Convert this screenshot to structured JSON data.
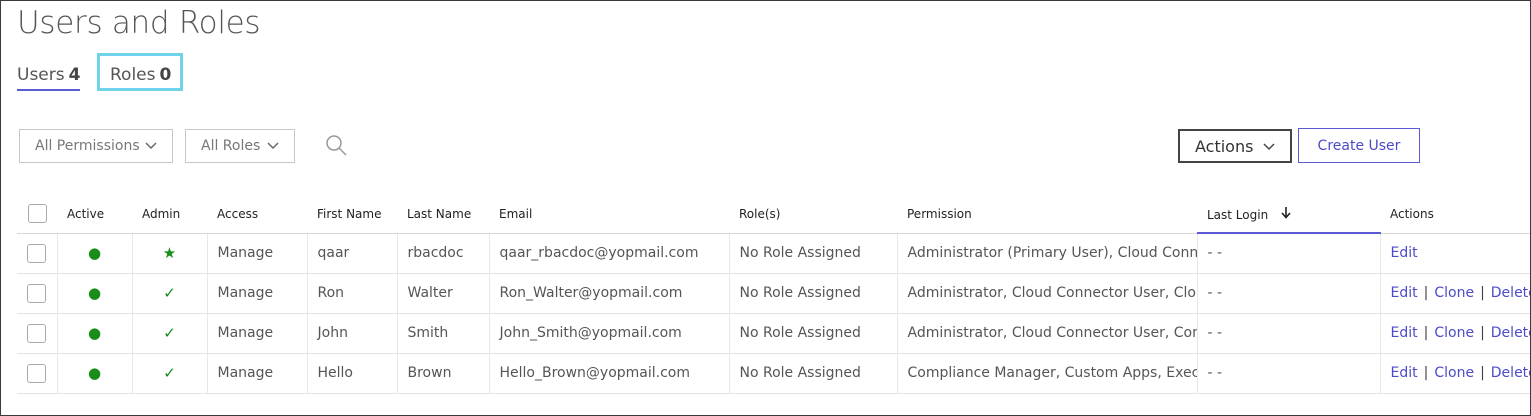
{
  "page": {
    "title": "Users and Roles"
  },
  "tabs": {
    "users": {
      "label": "Users",
      "count": "4"
    },
    "roles": {
      "label": "Roles",
      "count": "0"
    }
  },
  "filters": {
    "permissions": "All Permissions",
    "roles": "All Roles"
  },
  "toolbar": {
    "actions_label": "Actions",
    "create_user_label": "Create User"
  },
  "table": {
    "headers": {
      "active": "Active",
      "admin": "Admin",
      "access": "Access",
      "first_name": "First Name",
      "last_name": "Last Name",
      "email": "Email",
      "roles": "Role(s)",
      "permission": "Permission",
      "last_login": "Last Login",
      "actions": "Actions"
    },
    "sort": {
      "column": "Last Login",
      "direction": "descending"
    },
    "rows": [
      {
        "active": "●",
        "admin": "★",
        "access": "Manage",
        "first_name": "qaar",
        "last_name": "rbacdoc",
        "email": "qaar_rbacdoc@yopmail.com",
        "roles": "No Role Assigned",
        "permission": "Administrator (Primary User), Cloud Connector User, Compliance Manager",
        "last_login": "- -",
        "edit": "Edit"
      },
      {
        "active": "●",
        "admin": "✓",
        "access": "Manage",
        "first_name": "Ron",
        "last_name": "Walter",
        "email": "Ron_Walter@yopmail.com",
        "roles": "No Role Assigned",
        "permission": "Administrator, Cloud Connector User, Cloud Patch Management",
        "last_login": "- -",
        "edit": "Edit",
        "clone": "Clone",
        "delete": "Delete"
      },
      {
        "active": "●",
        "admin": "✓",
        "access": "Manage",
        "first_name": "John",
        "last_name": "Smith",
        "email": "John_Smith@yopmail.com",
        "roles": "No Role Assigned",
        "permission": "Administrator, Cloud Connector User, Compliance Manager",
        "last_login": "- -",
        "edit": "Edit",
        "clone": "Clone",
        "delete": "Delete"
      },
      {
        "active": "●",
        "admin": "✓",
        "access": "Manage",
        "first_name": "Hello",
        "last_name": "Brown",
        "email": "Hello_Brown@yopmail.com",
        "roles": "No Role Assigned",
        "permission": "Compliance Manager, Custom Apps, Executive",
        "last_login": "- -",
        "edit": "Edit",
        "clone": "Clone",
        "delete": "Delete"
      }
    ]
  },
  "colors": {
    "accent": "#5b5bd6",
    "highlight_box": "#6fd3ec",
    "status_green": "#1a8c1a",
    "link": "#4b4bc8"
  },
  "icons": {
    "search": "search-icon",
    "chevron": "chevron-down-icon",
    "sort": "arrow-down-icon"
  }
}
